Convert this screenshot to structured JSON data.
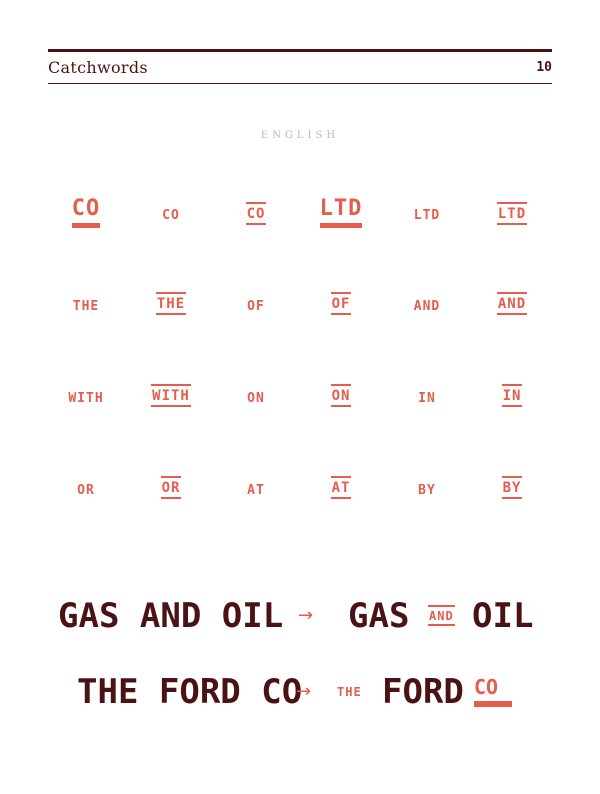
{
  "header": {
    "title": "Catchwords",
    "page_number": "10"
  },
  "section": {
    "label": "ENGLISH"
  },
  "catchwords": {
    "row1": [
      "CO",
      "CO",
      "CO",
      "LTD",
      "LTD",
      "LTD"
    ],
    "row2": [
      "THE",
      "THE",
      "OF",
      "OF",
      "AND",
      "AND"
    ],
    "row3": [
      "WITH",
      "WITH",
      "ON",
      "ON",
      "IN",
      "IN"
    ],
    "row4": [
      "OR",
      "OR",
      "AT",
      "AT",
      "BY",
      "BY"
    ]
  },
  "examples": {
    "gas": {
      "before": "GAS AND OIL",
      "arrow": "→",
      "after_left": "GAS",
      "after_small": "AND",
      "after_right": "OIL"
    },
    "ford": {
      "before": "THE FORD CO",
      "arrow": "→",
      "after_small": "THE",
      "after_main": "FORD",
      "after_co": "CO"
    }
  },
  "colors": {
    "accent": "#e55d4d",
    "ink": "#4a1214",
    "label_grey": "#b9b9b9"
  }
}
